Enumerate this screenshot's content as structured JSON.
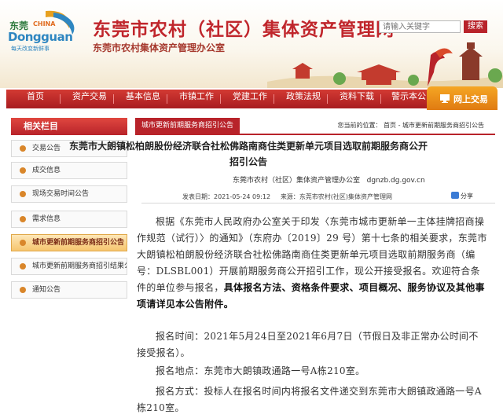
{
  "header": {
    "logo_cn": "东莞",
    "logo_china": "CHINA",
    "logo_en": "Dongguan",
    "logo_slogan": "每天改变新鲜事",
    "title": "东莞市农村（社区）集体资产管理网",
    "subtitle": "东莞市农村集体资产管理办公室",
    "search_placeholder": "请输入关键字",
    "search_button": "搜索"
  },
  "nav": {
    "items": [
      "首页",
      "资产交易",
      "基本信息",
      "市镇工作",
      "党建工作",
      "政策法规",
      "资料下载",
      "警示本公"
    ],
    "online": "网上交易"
  },
  "sidebar": {
    "title": "相关栏目",
    "items": [
      {
        "label": "交易公告"
      },
      {
        "label": "成交信息"
      },
      {
        "label": "现场交易时间公告"
      },
      {
        "label": "需求信息"
      },
      {
        "label": "城市更新前期服务商招引公告"
      },
      {
        "label": "城市更新前期服务商招引结果公示"
      },
      {
        "label": "通知公告"
      }
    ]
  },
  "content": {
    "tab": "城市更新前期服务商招引公告",
    "breadcrumb": "您当前的位置： 首页 - 城市更新前期服务商招引公告",
    "title_line1": "东莞市大朗镇松柏朗股份经济联合社松佛路南商住类更新单元项目选取前期服务商公开",
    "title_line2": "招引公告",
    "publisher": "东莞市农村（社区）集体资产管理办公室",
    "site": "dgnzb.dg.gov.cn",
    "publish_time_label": "发表日期：",
    "publish_time": "2021-05-24 09:12",
    "source_label": "来源：",
    "source": "东莞市农村(社区)集体资产管理网",
    "share": "分享",
    "p1_normal": "根据《东莞市人民政府办公室关于印发〈东莞市城市更新单一主体挂牌招商操作规范（试行）〉的通知》（东府办〔2019〕29 号）第十七条的相关要求，东莞市大朗镇松柏朗股份经济联合社松佛路南商住类更新单元项目选取前期服务商（编号：DLSBL001）开展前期服务商公开招引工作，现公开接受报名。欢迎符合条件的单位参与报名，",
    "p1_bold": "具体报名方法、资格条件要求、项目概况、服务协议及其他事项请详见本公告附件。",
    "p2": "报名时间：2021年5月24日至2021年6月7日（节假日及非正常办公时间不接受报名）。",
    "p3": "报名地点：东莞市大朗镇政通路一号A栋210室。",
    "p4": "报名方式：投标人在报名时间内将报名文件递交到东莞市大朗镇政通路一号A栋210室。"
  },
  "colors": {
    "primary_red": "#b8232a",
    "title_red": "#c0262c",
    "accent_orange": "#e07b12",
    "active_bg": "#f6c56e"
  }
}
